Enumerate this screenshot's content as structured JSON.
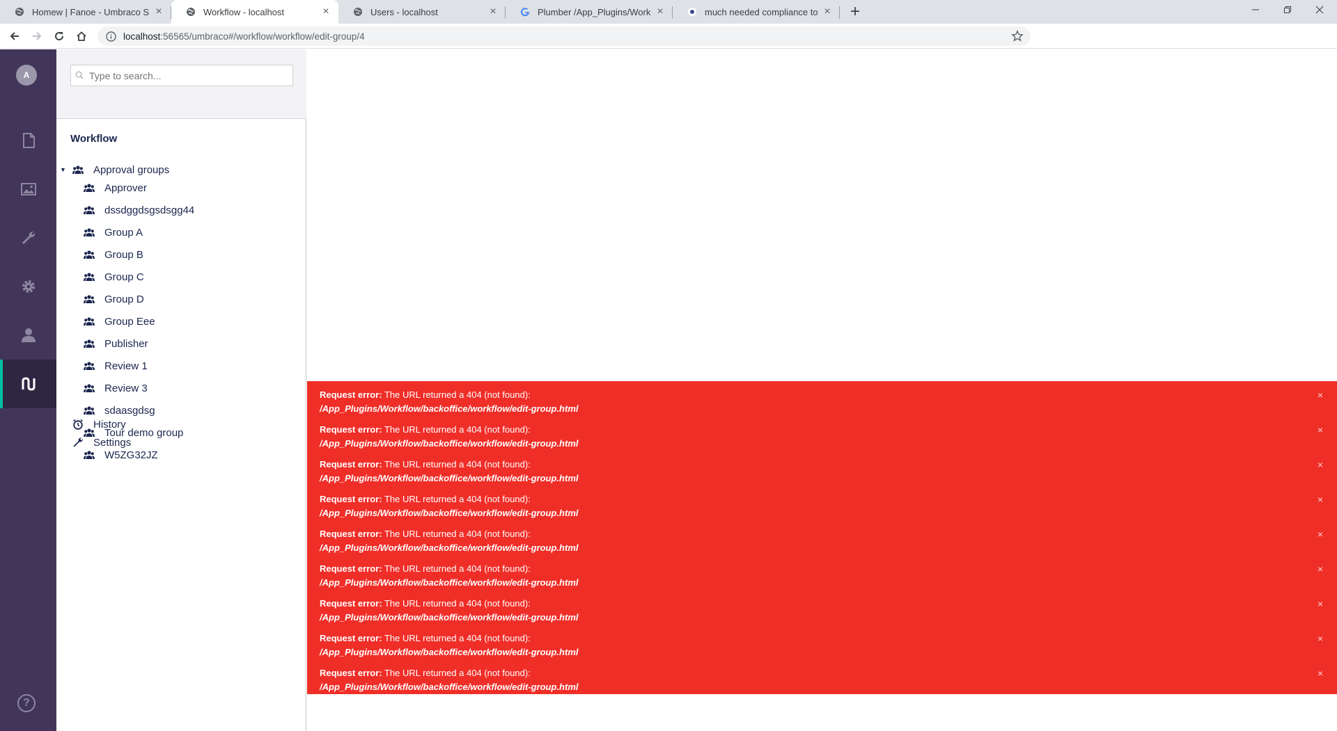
{
  "browser": {
    "tabs": [
      {
        "title": "Homew | Fanoe - Umbraco Starter",
        "icon": "globe-icon",
        "active": false
      },
      {
        "title": "Workflow - localhost",
        "icon": "globe-icon",
        "active": true
      },
      {
        "title": "Users - localhost",
        "icon": "globe-icon",
        "active": false
      },
      {
        "title": "Plumber /App_Plugins/Workflow",
        "icon": "google-icon",
        "active": false
      },
      {
        "title": "much needed compliance toolset",
        "icon": "site-icon",
        "active": false
      }
    ],
    "new_tab": "+",
    "close_glyph": "×",
    "url_host": "localhost",
    "url_path": ":56565/umbraco#/workflow/workflow/edit-group/4"
  },
  "app": {
    "user_initial": "A",
    "sections": [
      {
        "name": "content",
        "icon": "document-icon",
        "active": false
      },
      {
        "name": "media",
        "icon": "image-icon",
        "active": false
      },
      {
        "name": "settings",
        "icon": "wrench-icon",
        "active": false
      },
      {
        "name": "developer",
        "icon": "gear-icon",
        "active": false
      },
      {
        "name": "users",
        "icon": "user-icon",
        "active": false
      },
      {
        "name": "workflow",
        "icon": "workflow-icon",
        "active": true
      }
    ],
    "help_label": "?",
    "accent": "#00bea4",
    "sidebar_bg": "#413659"
  },
  "tree": {
    "search_placeholder": "Type to search...",
    "title": "Workflow",
    "root": {
      "label": "Approval groups",
      "icon": "users-icon"
    },
    "groups": [
      "Approver",
      "dssdggdsgsdsgg44",
      "Group A",
      "Group B",
      "Group C",
      "Group D",
      "Group Eee",
      "Publisher",
      "Review 1",
      "Review 3",
      "sdaasgdsg",
      "Tour demo group",
      "W5ZG32JZ"
    ],
    "history": {
      "label": "History",
      "icon": "clock-icon"
    },
    "settings": {
      "label": "Settings",
      "icon": "wrench-icon"
    }
  },
  "notifications": {
    "color": "#f02e28",
    "items": [
      {
        "heading": "Request error:",
        "message": "The URL returned a 404 (not found):",
        "path": "/App_Plugins/Workflow/backoffice/workflow/edit-group.html"
      },
      {
        "heading": "Request error:",
        "message": "The URL returned a 404 (not found):",
        "path": "/App_Plugins/Workflow/backoffice/workflow/edit-group.html"
      },
      {
        "heading": "Request error:",
        "message": "The URL returned a 404 (not found):",
        "path": "/App_Plugins/Workflow/backoffice/workflow/edit-group.html"
      },
      {
        "heading": "Request error:",
        "message": "The URL returned a 404 (not found):",
        "path": "/App_Plugins/Workflow/backoffice/workflow/edit-group.html"
      },
      {
        "heading": "Request error:",
        "message": "The URL returned a 404 (not found):",
        "path": "/App_Plugins/Workflow/backoffice/workflow/edit-group.html"
      },
      {
        "heading": "Request error:",
        "message": "The URL returned a 404 (not found):",
        "path": "/App_Plugins/Workflow/backoffice/workflow/edit-group.html"
      },
      {
        "heading": "Request error:",
        "message": "The URL returned a 404 (not found):",
        "path": "/App_Plugins/Workflow/backoffice/workflow/edit-group.html"
      },
      {
        "heading": "Request error:",
        "message": "The URL returned a 404 (not found):",
        "path": "/App_Plugins/Workflow/backoffice/workflow/edit-group.html"
      },
      {
        "heading": "Request error:",
        "message": "The URL returned a 404 (not found):",
        "path": "/App_Plugins/Workflow/backoffice/workflow/edit-group.html"
      }
    ]
  }
}
